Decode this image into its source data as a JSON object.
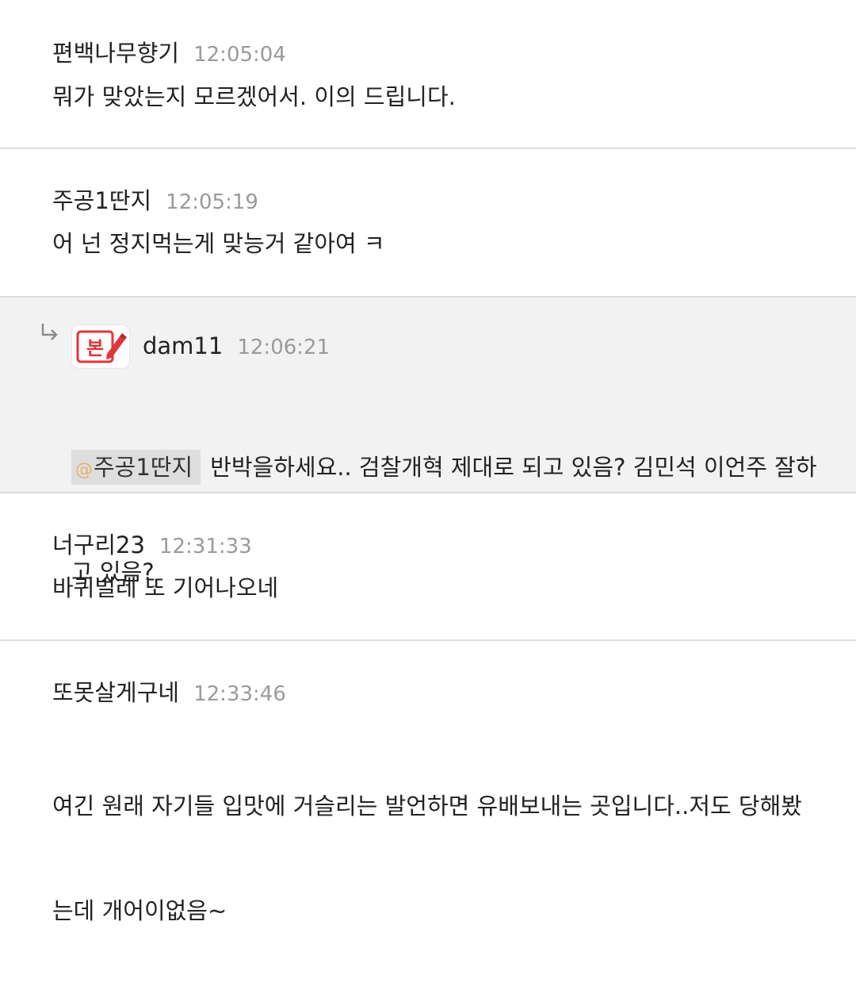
{
  "comments": [
    {
      "author": "편백나무향기",
      "time": "12:05:04",
      "text": "뭐가 맞았는지 모르겠어서. 이의 드립니다."
    },
    {
      "author": "주공1딴지",
      "time": "12:05:19",
      "text": "어 넌 정지먹는게 맞능거 같아여 ㅋ"
    },
    {
      "author": "dam11",
      "time": "12:06:21",
      "is_reply": true,
      "avatar_icon": "pencil-badge-icon",
      "avatar_label": "본",
      "mention": "주공1딴지",
      "text_line1": "반박을하세요.. 검찰개혁 제대로 되고 있음? 김민석 이언주 잘하",
      "text_line2": "고 있음?"
    },
    {
      "author": "너구리23",
      "time": "12:31:33",
      "text": "바퀴벌레 또 기어나오네"
    },
    {
      "author": "또못살게구네",
      "time": "12:33:46",
      "text_line1": "여긴 원래 자기들 입맛에 거슬리는 발언하면 유배보내는 곳입니다..저도 당해봤",
      "text_line2": "는데 개어이없음~"
    }
  ],
  "colors": {
    "divider": "#dcdcdc",
    "reply_background": "#f2f2f2",
    "time": "#9a9a9a",
    "mention_background": "#dedede",
    "avatar_red": "#e0353a"
  }
}
